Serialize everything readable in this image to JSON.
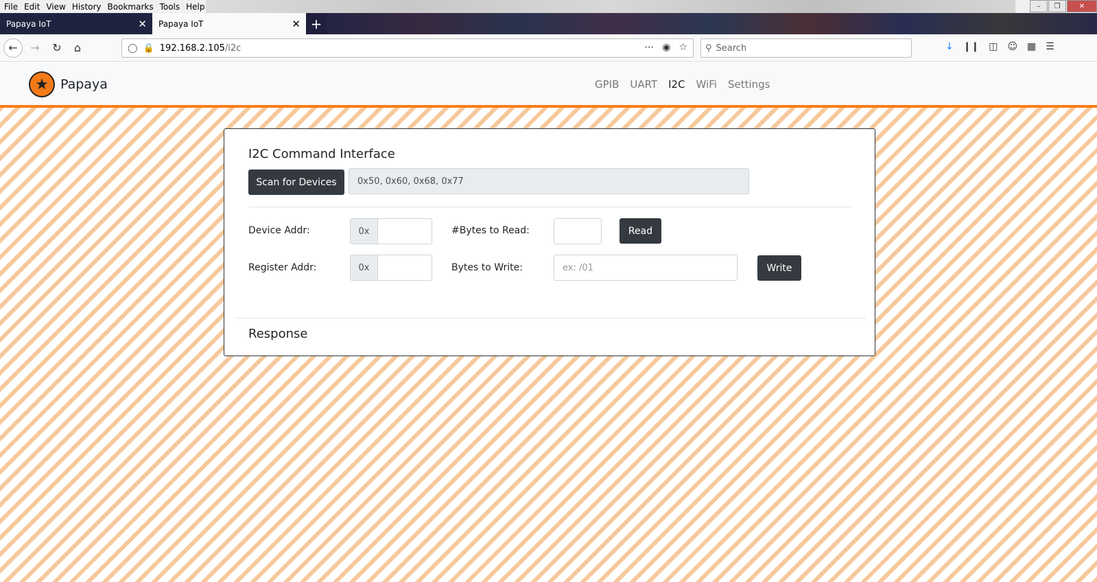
{
  "browser": {
    "menu": [
      "File",
      "Edit",
      "View",
      "History",
      "Bookmarks",
      "Tools",
      "Help"
    ],
    "tabs": [
      {
        "title": "Papaya IoT",
        "active": false
      },
      {
        "title": "Papaya IoT",
        "active": true
      }
    ],
    "url_host": "192.168.2.105",
    "url_path": "/i2c",
    "search_placeholder": "Search"
  },
  "site": {
    "brand": "Papaya",
    "nav": [
      "GPIB",
      "UART",
      "I2C",
      "WiFi",
      "Settings"
    ],
    "active_nav": "I2C",
    "accent_color": "#fd7e14"
  },
  "i2c": {
    "title": "I2C Command Interface",
    "scan_button": "Scan for Devices",
    "scan_result": "0x50, 0x60, 0x68, 0x77",
    "device_addr_label": "Device Addr:",
    "device_addr_prefix": "0x",
    "register_addr_label": "Register Addr:",
    "register_addr_prefix": "0x",
    "bytes_to_read_label": "#Bytes to Read:",
    "read_button": "Read",
    "bytes_to_write_label": "Bytes to Write:",
    "bytes_to_write_placeholder": "ex: /01",
    "write_button": "Write",
    "response_title": "Response"
  }
}
